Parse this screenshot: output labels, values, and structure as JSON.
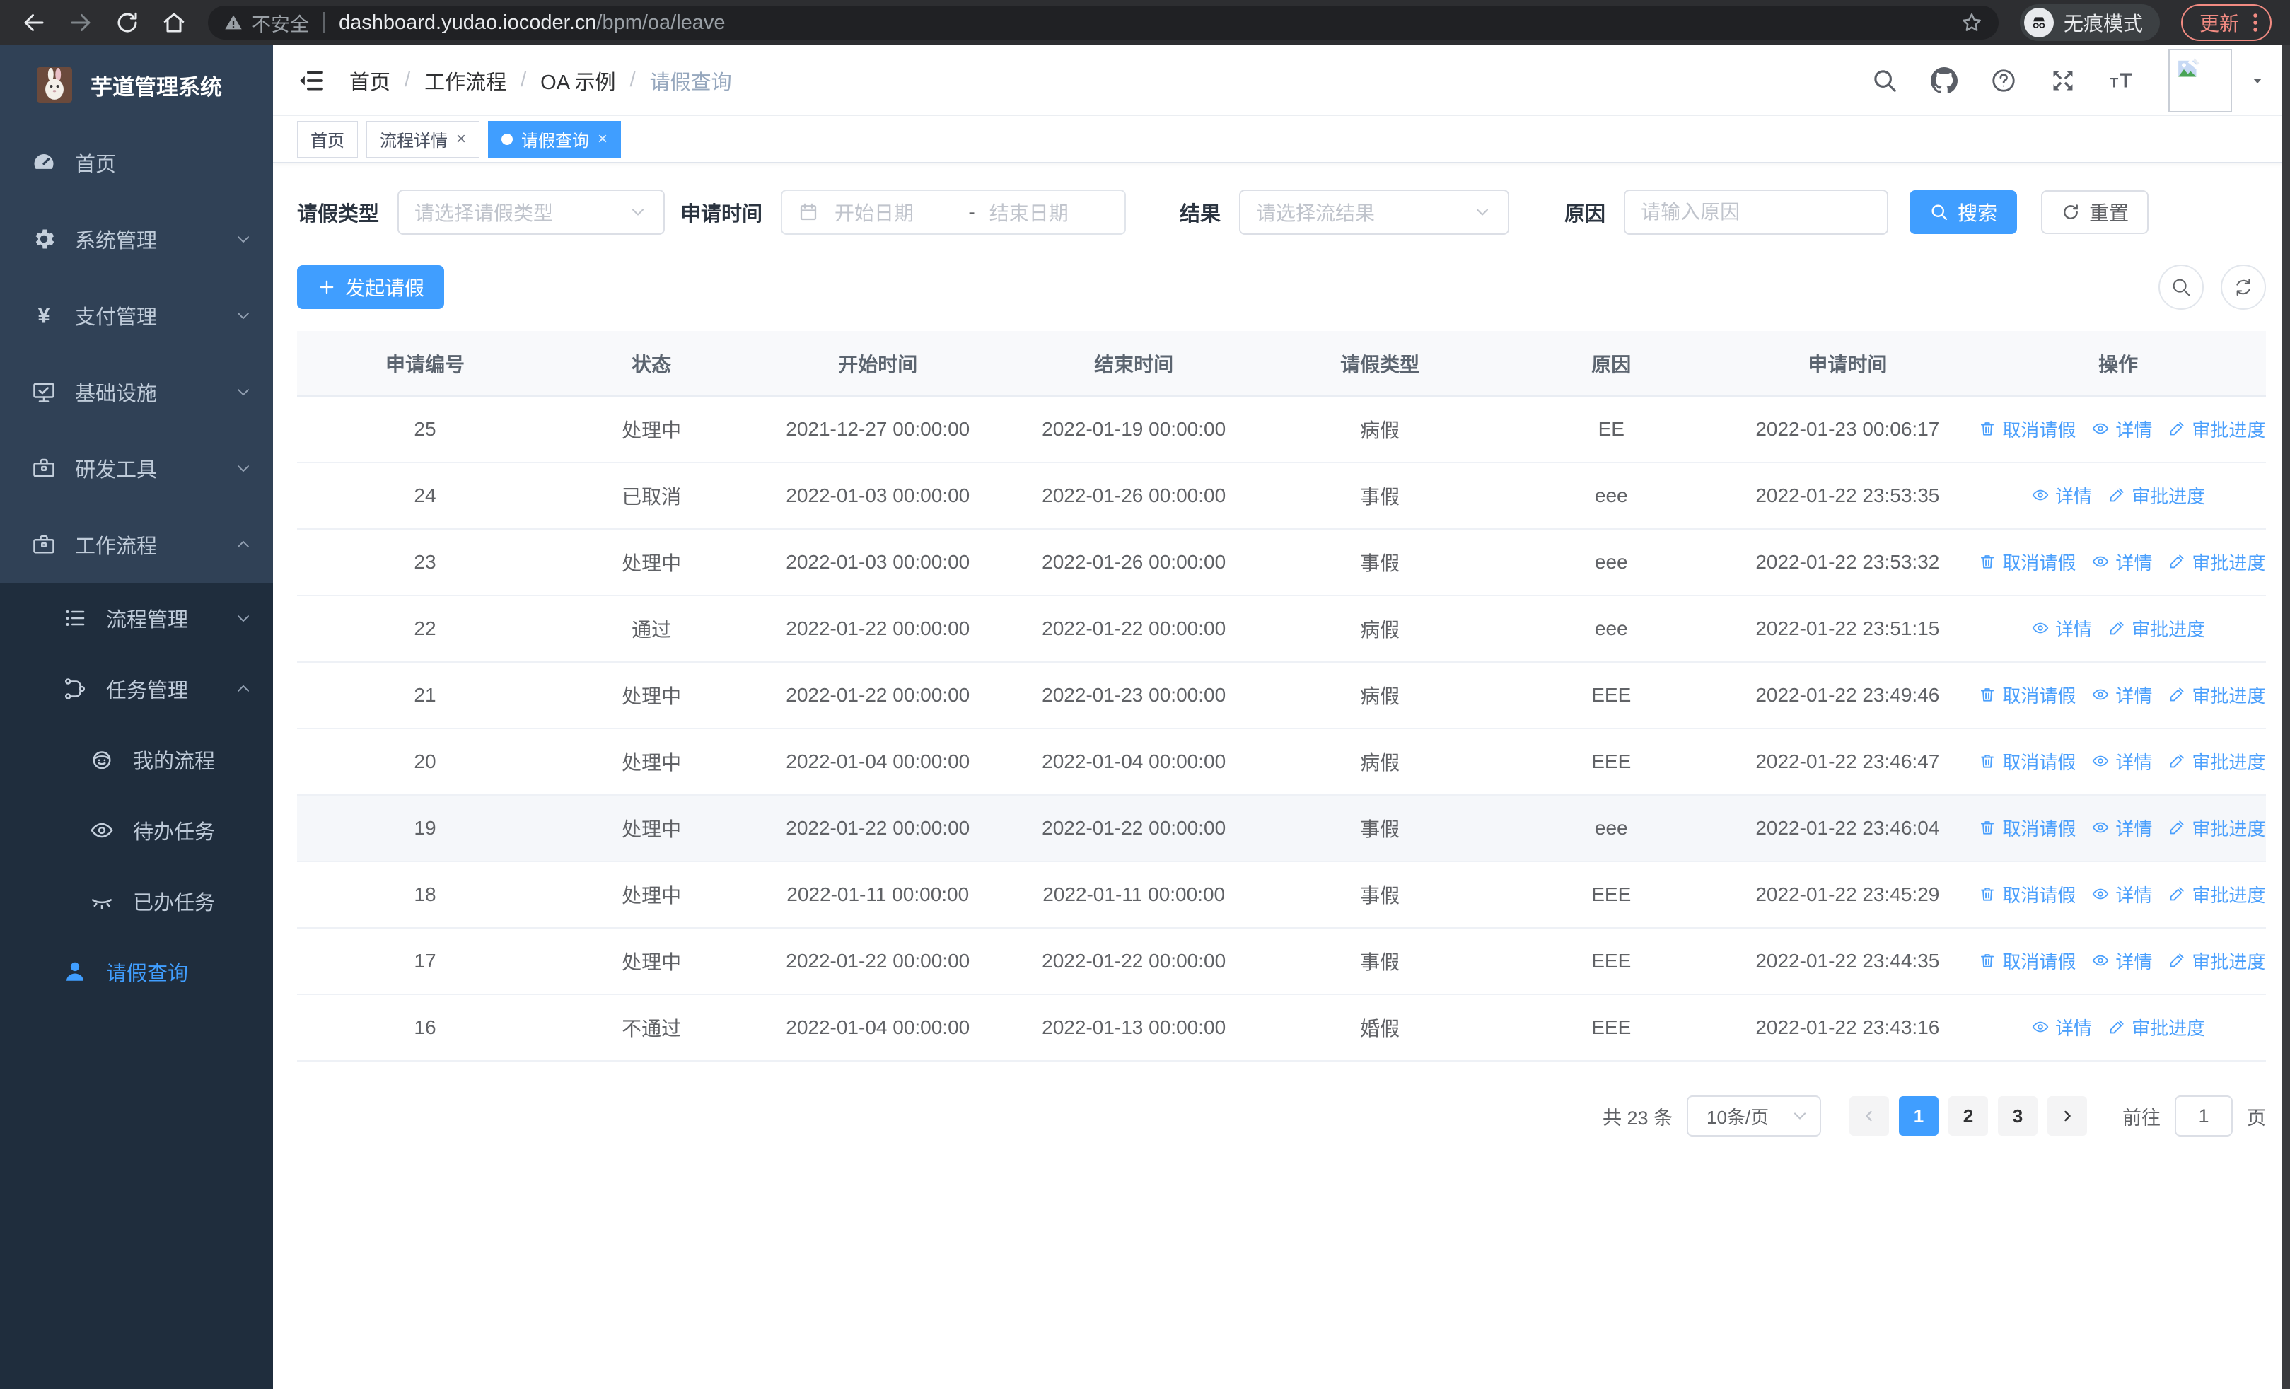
{
  "colors": {
    "primary": "#409eff",
    "sidebar_bg": "#304156",
    "submenu_bg": "#1f2d3d",
    "update_accent": "#f28b82"
  },
  "browser": {
    "not_secure_label": "不安全",
    "url_host": "dashboard.yudao.iocoder.cn",
    "url_path": "/bpm/oa/leave",
    "incognito_label": "无痕模式",
    "update_label": "更新"
  },
  "sidebar": {
    "app_title": "芋道管理系统",
    "menu": [
      {
        "name": "home",
        "label": "首页",
        "icon": "dashboard-icon",
        "level": 1,
        "chevron": null,
        "active": false
      },
      {
        "name": "system-management",
        "label": "系统管理",
        "icon": "gear-icon",
        "level": 1,
        "chevron": "down",
        "active": false
      },
      {
        "name": "payment-management",
        "label": "支付管理",
        "icon": "yen-icon",
        "level": 1,
        "chevron": "down",
        "active": false
      },
      {
        "name": "infrastructure",
        "label": "基础设施",
        "icon": "monitor-icon",
        "level": 1,
        "chevron": "down",
        "active": false
      },
      {
        "name": "dev-tools",
        "label": "研发工具",
        "icon": "briefcase-icon",
        "level": 1,
        "chevron": "down",
        "active": false
      },
      {
        "name": "workflow",
        "label": "工作流程",
        "icon": "briefcase-icon",
        "level": 1,
        "chevron": "up",
        "active": false
      }
    ],
    "submenu": [
      {
        "name": "process-management",
        "label": "流程管理",
        "icon": "list-icon",
        "level": 2,
        "chevron": "down",
        "active": false
      },
      {
        "name": "task-management",
        "label": "任务管理",
        "icon": "flow-icon",
        "level": 2,
        "chevron": "up",
        "active": false
      },
      {
        "name": "my-process",
        "label": "我的流程",
        "icon": "face-icon",
        "level": 3,
        "chevron": null,
        "active": false
      },
      {
        "name": "todo-tasks",
        "label": "待办任务",
        "icon": "eye-icon",
        "level": 3,
        "chevron": null,
        "active": false
      },
      {
        "name": "done-tasks",
        "label": "已办任务",
        "icon": "eye-closed-icon",
        "level": 3,
        "chevron": null,
        "active": false
      },
      {
        "name": "leave-query",
        "label": "请假查询",
        "icon": "person-icon",
        "level": 2,
        "chevron": null,
        "active": true
      }
    ]
  },
  "navbar": {
    "breadcrumb": [
      "首页",
      "工作流程",
      "OA 示例",
      "请假查询"
    ],
    "breadcrumb_separator": "/"
  },
  "tabs": [
    {
      "label": "首页",
      "closable": false,
      "active": false
    },
    {
      "label": "流程详情",
      "closable": true,
      "active": false
    },
    {
      "label": "请假查询",
      "closable": true,
      "active": true
    }
  ],
  "ui": {
    "close_glyph": "×"
  },
  "filters": {
    "leave_type_label": "请假类型",
    "leave_type_placeholder": "请选择请假类型",
    "apply_time_label": "申请时间",
    "start_date_placeholder": "开始日期",
    "range_separator": "-",
    "end_date_placeholder": "结束日期",
    "result_label": "结果",
    "result_placeholder": "请选择流结果",
    "reason_label": "原因",
    "reason_placeholder": "请输入原因",
    "search_label": "搜索",
    "reset_label": "重置"
  },
  "toolbar": {
    "create_label": "发起请假"
  },
  "table": {
    "headers": [
      "申请编号",
      "状态",
      "开始时间",
      "结束时间",
      "请假类型",
      "原因",
      "申请时间",
      "操作"
    ],
    "field_names": [
      "id",
      "status",
      "start-time",
      "end-time",
      "leave-type",
      "reason",
      "apply-time"
    ],
    "action_labels": {
      "cancel": "取消请假",
      "detail": "详情",
      "progress": "审批进度"
    },
    "rows": [
      {
        "id": "25",
        "status": "处理中",
        "start": "2021-12-27 00:00:00",
        "end": "2022-01-19 00:00:00",
        "type": "病假",
        "reason": "EE",
        "applied": "2022-01-23 00:06:17",
        "actions": [
          "cancel",
          "detail",
          "progress"
        ],
        "highlighted": false
      },
      {
        "id": "24",
        "status": "已取消",
        "start": "2022-01-03 00:00:00",
        "end": "2022-01-26 00:00:00",
        "type": "事假",
        "reason": "eee",
        "applied": "2022-01-22 23:53:35",
        "actions": [
          "detail",
          "progress"
        ],
        "highlighted": false
      },
      {
        "id": "23",
        "status": "处理中",
        "start": "2022-01-03 00:00:00",
        "end": "2022-01-26 00:00:00",
        "type": "事假",
        "reason": "eee",
        "applied": "2022-01-22 23:53:32",
        "actions": [
          "cancel",
          "detail",
          "progress"
        ],
        "highlighted": false
      },
      {
        "id": "22",
        "status": "通过",
        "start": "2022-01-22 00:00:00",
        "end": "2022-01-22 00:00:00",
        "type": "病假",
        "reason": "eee",
        "applied": "2022-01-22 23:51:15",
        "actions": [
          "detail",
          "progress"
        ],
        "highlighted": false
      },
      {
        "id": "21",
        "status": "处理中",
        "start": "2022-01-22 00:00:00",
        "end": "2022-01-23 00:00:00",
        "type": "病假",
        "reason": "EEE",
        "applied": "2022-01-22 23:49:46",
        "actions": [
          "cancel",
          "detail",
          "progress"
        ],
        "highlighted": false
      },
      {
        "id": "20",
        "status": "处理中",
        "start": "2022-01-04 00:00:00",
        "end": "2022-01-04 00:00:00",
        "type": "病假",
        "reason": "EEE",
        "applied": "2022-01-22 23:46:47",
        "actions": [
          "cancel",
          "detail",
          "progress"
        ],
        "highlighted": false
      },
      {
        "id": "19",
        "status": "处理中",
        "start": "2022-01-22 00:00:00",
        "end": "2022-01-22 00:00:00",
        "type": "事假",
        "reason": "eee",
        "applied": "2022-01-22 23:46:04",
        "actions": [
          "cancel",
          "detail",
          "progress"
        ],
        "highlighted": true
      },
      {
        "id": "18",
        "status": "处理中",
        "start": "2022-01-11 00:00:00",
        "end": "2022-01-11 00:00:00",
        "type": "事假",
        "reason": "EEE",
        "applied": "2022-01-22 23:45:29",
        "actions": [
          "cancel",
          "detail",
          "progress"
        ],
        "highlighted": false
      },
      {
        "id": "17",
        "status": "处理中",
        "start": "2022-01-22 00:00:00",
        "end": "2022-01-22 00:00:00",
        "type": "事假",
        "reason": "EEE",
        "applied": "2022-01-22 23:44:35",
        "actions": [
          "cancel",
          "detail",
          "progress"
        ],
        "highlighted": false
      },
      {
        "id": "16",
        "status": "不通过",
        "start": "2022-01-04 00:00:00",
        "end": "2022-01-13 00:00:00",
        "type": "婚假",
        "reason": "EEE",
        "applied": "2022-01-22 23:43:16",
        "actions": [
          "detail",
          "progress"
        ],
        "highlighted": false
      }
    ]
  },
  "pagination": {
    "total": "共 23 条",
    "page_size": "10条/页",
    "pages": [
      "1",
      "2",
      "3"
    ],
    "active_page": "1",
    "goto_label": "前往",
    "goto_value": "1",
    "page_label": "页"
  }
}
